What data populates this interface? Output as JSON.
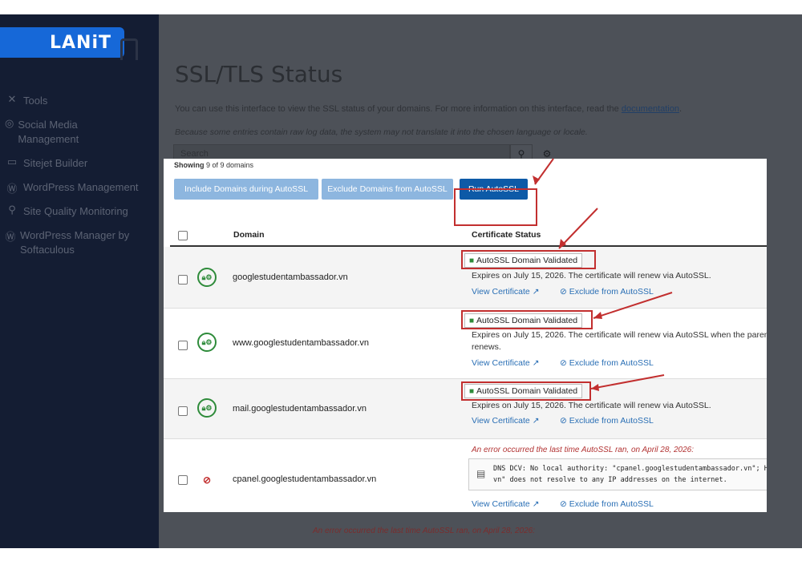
{
  "brand": {
    "logo_text": "LANiT"
  },
  "sidebar": {
    "items": [
      {
        "label": "Tools",
        "icon": "tools-icon"
      },
      {
        "label": "Social Media Management",
        "icon": "social-media-icon"
      },
      {
        "label": "Sitejet Builder",
        "icon": "sitejet-icon"
      },
      {
        "label": "WordPress Management",
        "icon": "wordpress-icon"
      },
      {
        "label": "Site Quality Monitoring",
        "icon": "search-icon"
      },
      {
        "label": "WordPress Manager by Softaculous",
        "icon": "wordpress-icon"
      }
    ]
  },
  "page": {
    "title": "SSL/TLS Status",
    "intro": "You can use this interface to view the SSL status of your domains. For more information on this interface, read the",
    "intro_link": "documentation",
    "note": "Because some entries contain raw log data, the system may not translate it into the chosen language or locale.",
    "search_placeholder": "Search"
  },
  "panel": {
    "showing_prefix": "Showing",
    "showing_value": "9 of 9 domains",
    "buttons": {
      "include": "Include Domains during AutoSSL",
      "exclude": "Exclude Domains from AutoSSL",
      "run": "Run AutoSSL"
    },
    "columns": {
      "domain": "Domain",
      "status": "Certificate Status"
    },
    "rows": [
      {
        "domain": "googlestudentambassador.vn",
        "badge": "AutoSSL Domain Validated",
        "expires": "Expires on July 15, 2026. The certificate will renew via AutoSSL.",
        "view": "View Certificate",
        "exclude": "Exclude from AutoSSL"
      },
      {
        "domain": "www.googlestudentambassador.vn",
        "badge": "AutoSSL Domain Validated",
        "expires": "Expires on July 15, 2026. The certificate will renew via AutoSSL when the parent doma",
        "expires2": "renews.",
        "view": "View Certificate",
        "exclude": "Exclude from AutoSSL"
      },
      {
        "domain": "mail.googlestudentambassador.vn",
        "badge": "AutoSSL Domain Validated",
        "expires": "Expires on July 15, 2026. The certificate will renew via AutoSSL.",
        "view": "View Certificate",
        "exclude": "Exclude from AutoSSL"
      },
      {
        "domain": "cpanel.googlestudentambassador.vn",
        "error": "An error occurred the last time AutoSSL ran, on April 28, 2026:",
        "log_line1": "DNS DCV: No local authority: \"cpanel.googlestudentambassador.vn\"; HTTP D",
        "log_line2": "vn\" does not resolve to any IP addresses on the internet.",
        "view": "View Certificate",
        "exclude": "Exclude from AutoSSL"
      }
    ],
    "below_error": "An error occurred the last time AutoSSL ran, on April 28, 2026:"
  },
  "colors": {
    "sidebar_bg": "#141d33",
    "brand_blue": "#1668d8",
    "run_button": "#0d5aa7",
    "secondary_button": "#8db6df",
    "success_green": "#2e8b3a",
    "annotation_red": "#c22f2f",
    "link_blue": "#2a6fb5"
  }
}
